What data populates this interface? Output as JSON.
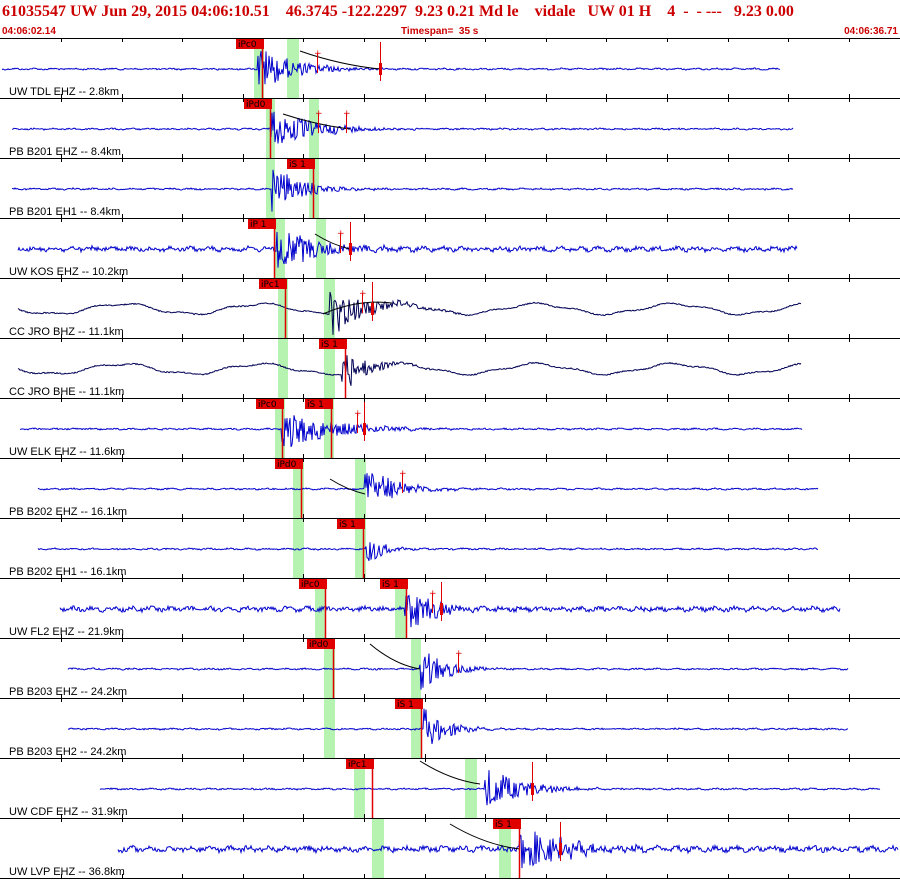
{
  "header": {
    "title": "61035547 UW Jun 29, 2015 04:06:10.51    46.3745 -122.2297  9.23 0.21 Md le    vidale   UW 01 H    4  -  - ---   9.23 0.00",
    "start_time": "04:06:02.14",
    "timespan_label": "Timespan=  35 s",
    "end_time": "04:06:36.71"
  },
  "colors": {
    "trace": "#0000cc",
    "trace_broadband": "#000055",
    "pick_flag": "#e00000",
    "pick_text": "#000000",
    "window": "#b6f2b0",
    "grid": "#000000",
    "label": "#000000"
  },
  "channels": [
    {
      "label": "UW TDL EHZ -- 2.8km",
      "type": "short-period",
      "picks": [
        "iPc0"
      ]
    },
    {
      "label": "PB B201 EHZ -- 8.4km",
      "type": "short-period",
      "picks": [
        "iPd0"
      ]
    },
    {
      "label": "PB B201 EH1 -- 8.4km",
      "type": "short-period",
      "picks": [
        "iS 1"
      ]
    },
    {
      "label": "UW KOS EHZ -- 10.2km",
      "type": "short-period",
      "picks": [
        "iP 1"
      ]
    },
    {
      "label": "CC JRO BHZ -- 11.1km",
      "type": "broadband",
      "picks": [
        "iPc1"
      ]
    },
    {
      "label": "CC JRO BHE -- 11.1km",
      "type": "broadband",
      "picks": [
        "iS 1"
      ]
    },
    {
      "label": "UW ELK EHZ -- 11.6km",
      "type": "short-period",
      "picks": [
        "iPc0",
        "iS 1"
      ]
    },
    {
      "label": "PB B202 EHZ -- 16.1km",
      "type": "short-period",
      "picks": [
        "iPd0"
      ]
    },
    {
      "label": "PB B202 EH1 -- 16.1km",
      "type": "short-period",
      "picks": [
        "iS 1"
      ]
    },
    {
      "label": "UW FL2 EHZ -- 21.9km",
      "type": "short-period",
      "picks": [
        "iPc0",
        "iS 1"
      ]
    },
    {
      "label": "PB B203 EHZ -- 24.2km",
      "type": "short-period",
      "picks": [
        "iPd0"
      ]
    },
    {
      "label": "PB B203 EH2 -- 24.2km",
      "type": "short-period",
      "picks": [
        "iS 1"
      ]
    },
    {
      "label": "UW CDF EHZ -- 31.9km",
      "type": "short-period",
      "picks": [
        "iPc1"
      ]
    },
    {
      "label": "UW LVP EHZ -- 36.8km",
      "type": "short-period",
      "picks": [
        "iS 1"
      ]
    }
  ]
}
